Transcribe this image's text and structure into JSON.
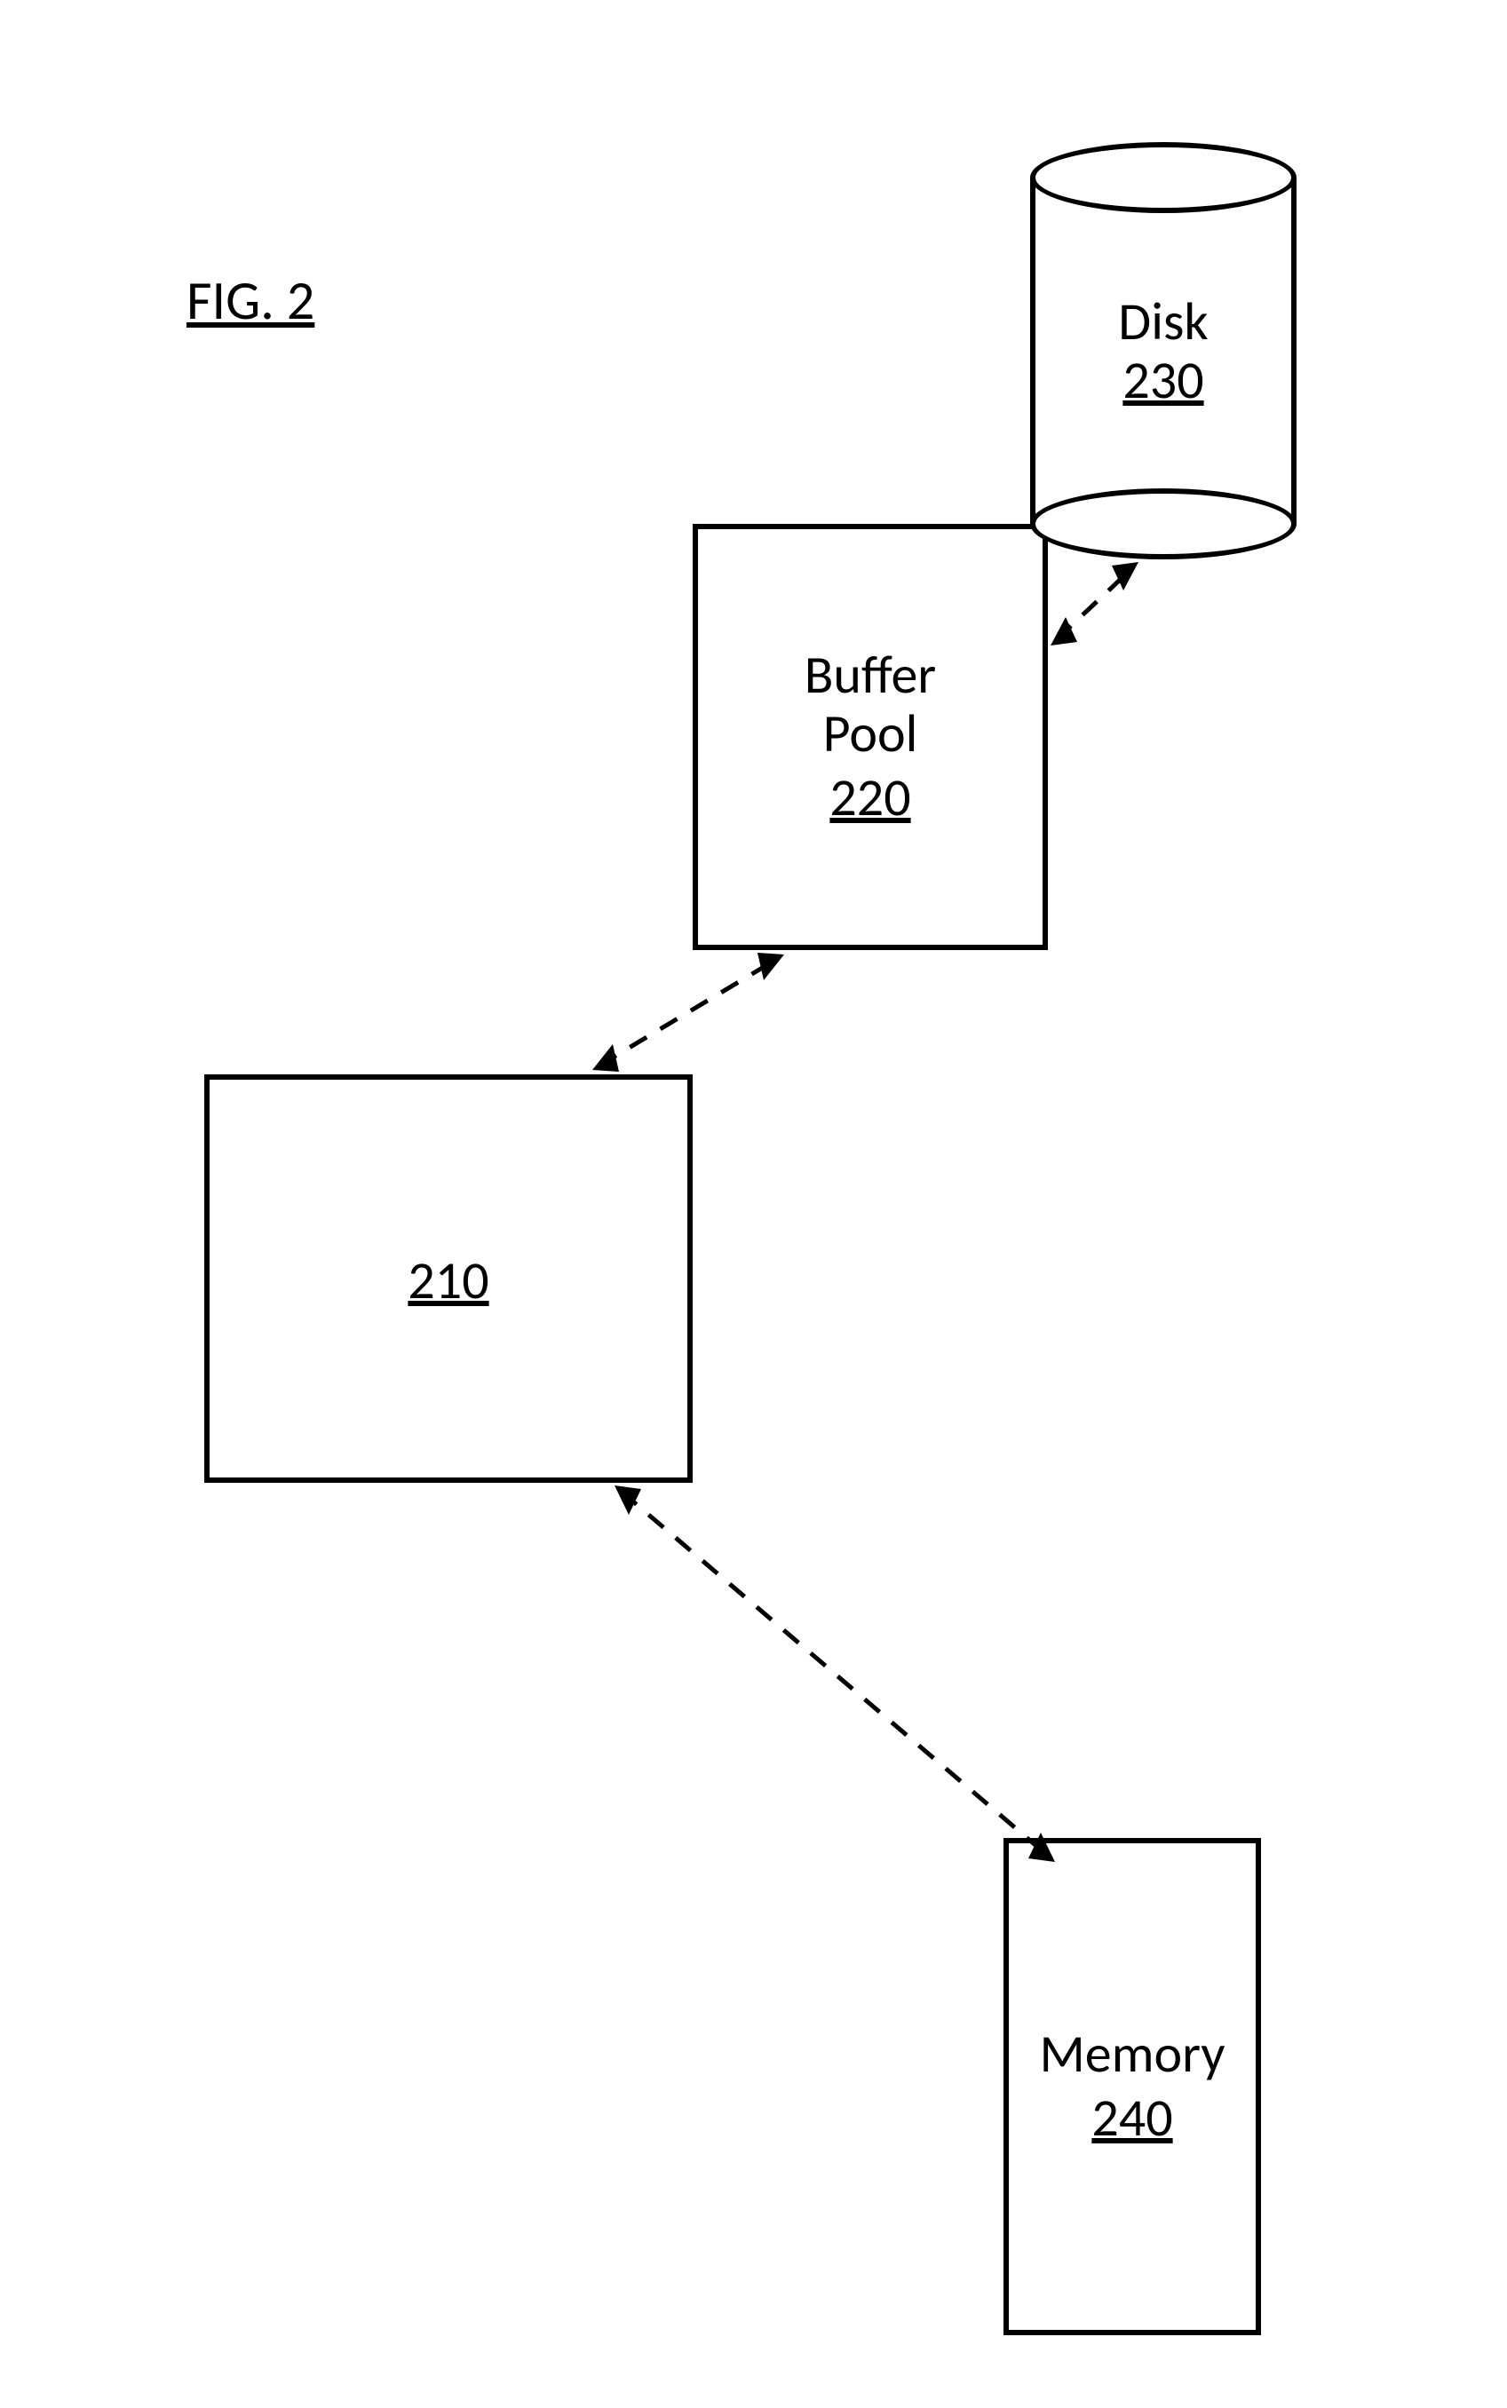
{
  "figure": {
    "label": "FIG. 2"
  },
  "nodes": {
    "central": {
      "ref": "210"
    },
    "buffer_pool": {
      "line1": "Buffer",
      "line2": "Pool",
      "ref": "220"
    },
    "disk": {
      "label": "Disk",
      "ref": "230"
    },
    "memory": {
      "label": "Memory",
      "ref": "240"
    }
  }
}
